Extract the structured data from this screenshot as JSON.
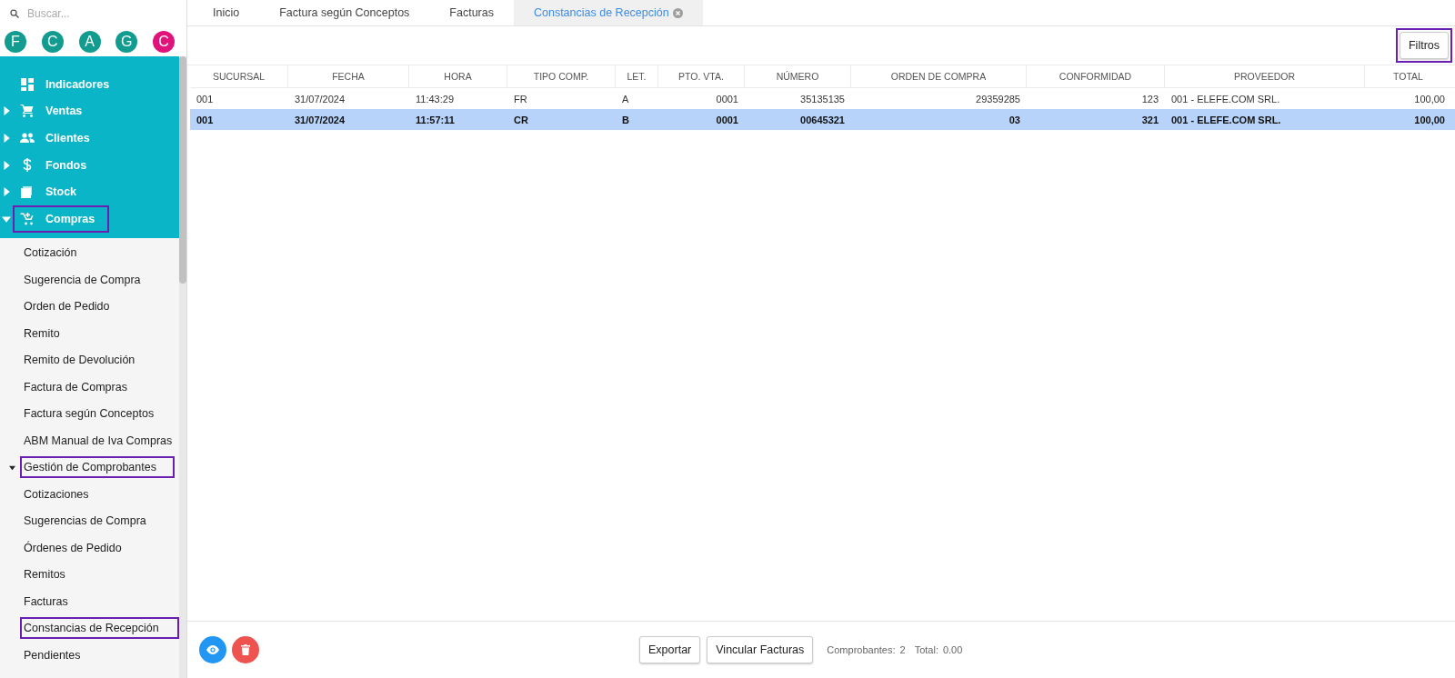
{
  "sidebar": {
    "search": {
      "placeholder": "Buscar..."
    },
    "avatars": [
      {
        "letter": "F",
        "color": "#129c8f"
      },
      {
        "letter": "C",
        "color": "#129c8f"
      },
      {
        "letter": "A",
        "color": "#129c8f"
      },
      {
        "letter": "G",
        "color": "#129c8f"
      },
      {
        "letter": "C",
        "color": "#e0137b"
      }
    ],
    "menu": [
      {
        "label": "Indicadores",
        "highlighted": false
      },
      {
        "label": "Ventas",
        "expanded": false,
        "highlighted": false
      },
      {
        "label": "Clientes",
        "expanded": false,
        "highlighted": false
      },
      {
        "label": "Fondos",
        "expanded": false,
        "highlighted": false
      },
      {
        "label": "Stock",
        "expanded": false,
        "highlighted": false
      },
      {
        "label": "Compras",
        "expanded": true,
        "highlighted": true,
        "children": [
          {
            "label": "Cotización",
            "highlighted": false
          },
          {
            "label": "Sugerencia de Compra",
            "highlighted": false
          },
          {
            "label": "Orden de Pedido",
            "highlighted": false
          },
          {
            "label": "Remito",
            "highlighted": false
          },
          {
            "label": "Remito de Devolución",
            "highlighted": false
          },
          {
            "label": "Factura de Compras",
            "highlighted": false
          },
          {
            "label": "Factura según Conceptos",
            "highlighted": false
          },
          {
            "label": "ABM Manual de Iva Compras",
            "highlighted": false
          },
          {
            "label": "Gestión de Comprobantes",
            "expanded": true,
            "highlighted": true,
            "children": [
              {
                "label": "Cotizaciones",
                "highlighted": false
              },
              {
                "label": "Sugerencias de Compra",
                "highlighted": false
              },
              {
                "label": "Órdenes de Pedido",
                "highlighted": false
              },
              {
                "label": "Remitos",
                "highlighted": false
              },
              {
                "label": "Facturas",
                "highlighted": false
              },
              {
                "label": "Constancias de Recepción",
                "highlighted": true
              }
            ]
          },
          {
            "label": "Pendientes",
            "highlighted": false
          }
        ]
      }
    ]
  },
  "tabs": [
    {
      "label": "Inicio",
      "selected": false
    },
    {
      "label": "Factura según Conceptos",
      "selected": false
    },
    {
      "label": "Facturas",
      "selected": false
    },
    {
      "label": "Constancias de Recepción",
      "selected": true
    }
  ],
  "toolbar": {
    "filter_button": {
      "label": "Filtros",
      "highlighted": true
    }
  },
  "table": {
    "columns": [
      "SUCURSAL",
      "FECHA",
      "HORA",
      "TIPO COMP.",
      "LET.",
      "PTO. VTA.",
      "NÚMERO",
      "ORDEN DE COMPRA",
      "CONFORMIDAD",
      "PROVEEDOR",
      "TOTAL"
    ],
    "rows": [
      {
        "selected": false,
        "cells": [
          "001",
          "31/07/2024",
          "11:43:29",
          "FR",
          "A",
          "0001",
          "35135135",
          "29359285",
          "123",
          "001 - ELEFE.COM SRL.",
          "100,00"
        ]
      },
      {
        "selected": true,
        "cells": [
          "001",
          "31/07/2024",
          "11:57:11",
          "CR",
          "B",
          "0001",
          "00645321",
          "03",
          "321",
          "001 - ELEFE.COM SRL.",
          "100,00"
        ]
      }
    ]
  },
  "footer": {
    "buttons": [
      "Exportar",
      "Vincular Facturas"
    ],
    "summary": [
      {
        "label": "Comprobantes:",
        "value": "2"
      },
      {
        "label": "Total:",
        "value": "0.00"
      }
    ]
  }
}
